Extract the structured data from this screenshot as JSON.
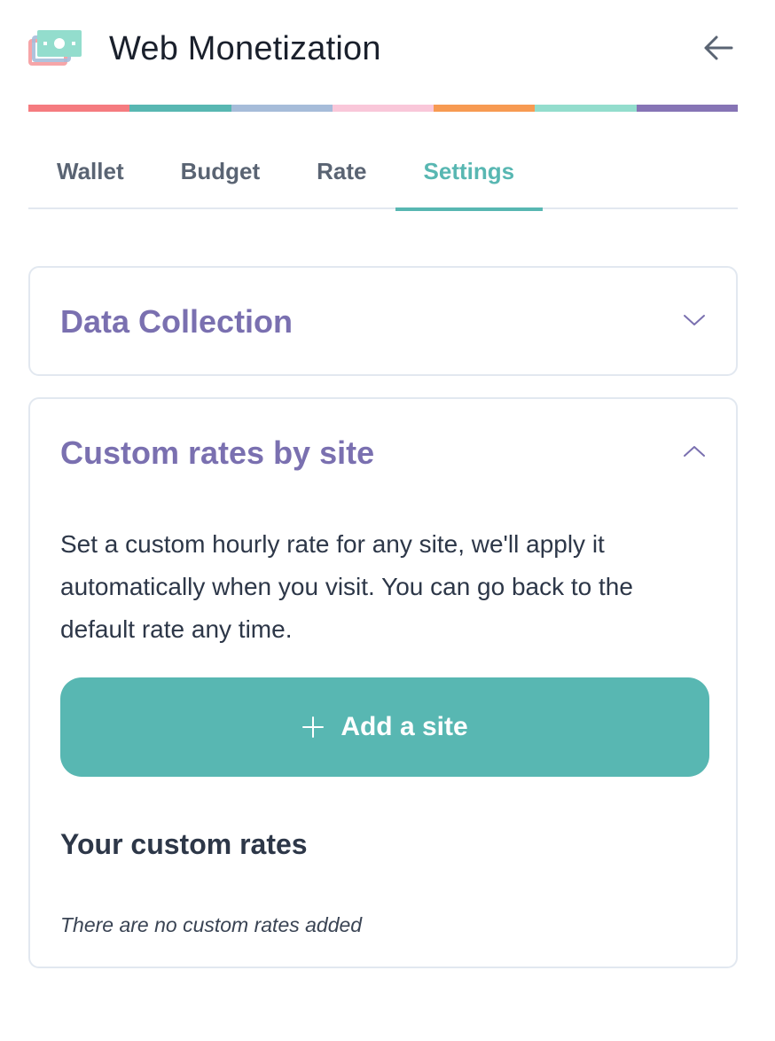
{
  "header": {
    "title": "Web Monetization",
    "logo_icon": "money-bill-logo-icon",
    "back_icon": "arrow-left-icon"
  },
  "stripe_colors": [
    "#f57b7f",
    "#58b7b2",
    "#a6bcd9",
    "#f9c7d9",
    "#f79a52",
    "#93ddcd",
    "#8674b5"
  ],
  "tabs": [
    {
      "label": "Wallet",
      "active": false
    },
    {
      "label": "Budget",
      "active": false
    },
    {
      "label": "Rate",
      "active": false
    },
    {
      "label": "Settings",
      "active": true
    }
  ],
  "sections": {
    "data_collection": {
      "title": "Data Collection",
      "expanded": false,
      "chevron_icon": "chevron-down-icon"
    },
    "custom_rates": {
      "title": "Custom rates by site",
      "expanded": true,
      "chevron_icon": "chevron-up-icon",
      "description": "Set a custom hourly rate for any site, we'll apply it automatically when you visit. You can go back to the default rate any time.",
      "add_button_label": "Add a site",
      "add_button_icon": "plus-icon",
      "list_title": "Your custom rates",
      "empty_text": "There are no custom rates added"
    }
  },
  "colors": {
    "accent": "#58b7b2",
    "section_title": "#7a70b0",
    "text": "#2d3748"
  }
}
